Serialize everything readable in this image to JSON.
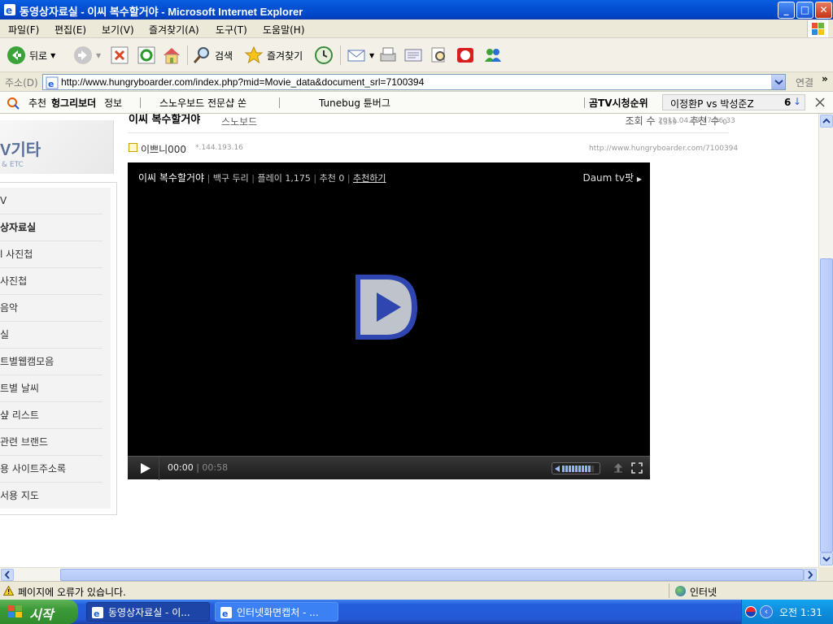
{
  "window": {
    "title": "동영상자료실 - 이씨 복수할거야 - Microsoft Internet Explorer",
    "minimize": "_",
    "maximize": "□",
    "close": "✕"
  },
  "menu": [
    "파일(F)",
    "편집(E)",
    "보기(V)",
    "즐겨찾기(A)",
    "도구(T)",
    "도움말(H)"
  ],
  "toolbar": {
    "back_label": "뒤로",
    "search_label": "검색",
    "favorites_label": "즐겨찾기",
    "icons": [
      "back-icon",
      "forward-icon",
      "stop-icon",
      "refresh-icon",
      "home-icon",
      "search-icon",
      "favorites-icon",
      "history-icon",
      "mail-icon",
      "print-icon",
      "edit-icon",
      "research-icon",
      "messenger-icon"
    ]
  },
  "address": {
    "label": "주소(D)",
    "url": "http://www.hungryboarder.com/index.php?mid=Movie_data&document_srl=7100394",
    "go_label": "연결",
    "more": "»"
  },
  "linkbar": {
    "recommend_prefix": "추천",
    "recommend_bold": "헝그리보더",
    "recommend_suffix": "정보",
    "link1": "스노우보드 전문샵 쏜",
    "link2": "Tunebug 튠버그",
    "tv_rank": "곰TV시청순위",
    "tv_item": "이정환P vs 박성준Z",
    "tv_num": "6"
  },
  "sidebar": {
    "banner_big": "V기타",
    "banner_small": "& ETC",
    "items": [
      {
        "label": "V",
        "active": false
      },
      {
        "label": "상자료실",
        "active": true
      },
      {
        "label": "l 사진첩",
        "active": false
      },
      {
        "label": "사진첩",
        "active": false
      },
      {
        "label": "음악",
        "active": false
      },
      {
        "label": "실",
        "active": false
      },
      {
        "label": "트별웹캠모음",
        "active": false
      },
      {
        "label": "트별 날씨",
        "active": false
      },
      {
        "label": "샾 리스트",
        "active": false
      },
      {
        "label": "관련 브랜드",
        "active": false
      },
      {
        "label": "용 사이트주소록",
        "active": false
      },
      {
        "label": "서용 지도",
        "active": false
      }
    ]
  },
  "article": {
    "title": "이씨 복수할거야",
    "category": "스노보드",
    "views_label": "조회 수",
    "views": "1359",
    "recommend_label": "추천 수",
    "recommend": "0",
    "datetime": "2011.04.29 17:06:33",
    "author": "이쁘니000",
    "ip": "*.144.193.16",
    "url": "http://www.hungryboarder.com/7100394"
  },
  "player": {
    "title": "이씨 복수할거야",
    "channel": "백구 두리",
    "plays_label": "플레이",
    "plays": "1,175",
    "recommend_label": "추천",
    "recommend": "0",
    "recommend_link": "추천하기",
    "brand": "Daum tv팟",
    "current_time": "00:00",
    "duration": "00:58",
    "progress": 0,
    "volume_level": 0.85
  },
  "status": {
    "message": "페이지에 오류가 있습니다.",
    "zone": "인터넷"
  },
  "taskbar": {
    "start": "시작",
    "tasks": [
      {
        "label": "동영상자료실 - 이...",
        "active": true
      },
      {
        "label": "인터넷화면캡처 - ...",
        "active": false
      }
    ],
    "clock": "오전 1:31"
  },
  "colors": {
    "xp_blue": "#0350d3",
    "taskbar_green": "#3c9a38",
    "player_bg": "#000000",
    "daum_logo": "#2a3fa8"
  }
}
